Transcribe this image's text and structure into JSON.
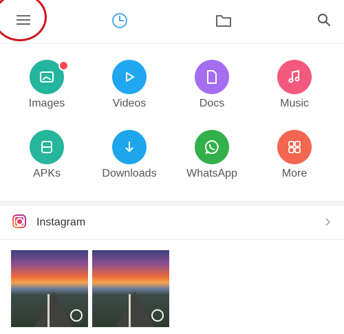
{
  "header": {
    "menu_icon": "hamburger-menu-icon",
    "tabs": [
      {
        "icon": "clock-icon",
        "active": true
      },
      {
        "icon": "folder-icon",
        "active": false
      }
    ],
    "search_icon": "search-icon",
    "accent_color": "#4aa8f0",
    "highlight_color": "#d0121c"
  },
  "categories": [
    {
      "label": "Images",
      "icon": "image-icon",
      "color": "#24b59e",
      "badge": true
    },
    {
      "label": "Videos",
      "icon": "play-icon",
      "color": "#21a7ef"
    },
    {
      "label": "Docs",
      "icon": "document-icon",
      "color": "#a56df0"
    },
    {
      "label": "Music",
      "icon": "music-note-icon",
      "color": "#f2597d"
    },
    {
      "label": "APKs",
      "icon": "apk-icon",
      "color": "#26b69b"
    },
    {
      "label": "Downloads",
      "icon": "download-icon",
      "color": "#1ea6ec"
    },
    {
      "label": "WhatsApp",
      "icon": "whatsapp-icon",
      "color": "#32b049"
    },
    {
      "label": "More",
      "icon": "grid-more-icon",
      "color": "#f3664f"
    }
  ],
  "instagram": {
    "title": "Instagram",
    "icon": "instagram-icon",
    "thumbnails": [
      {
        "selected": false
      },
      {
        "selected": false
      }
    ]
  }
}
